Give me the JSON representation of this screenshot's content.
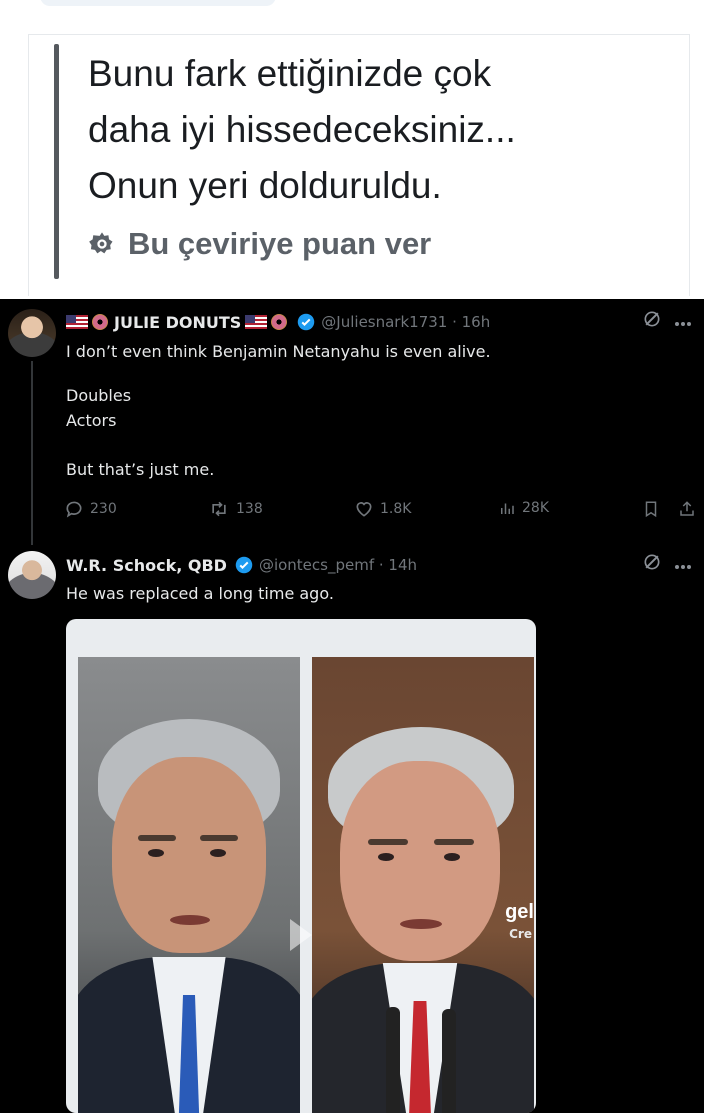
{
  "translation": {
    "lines": [
      "Bunu fark ettiğinizde çok",
      "daha iyi hissedeceksiniz...",
      "Onun yeri dolduruldu."
    ],
    "rate_label": "Bu çeviriye puan ver",
    "rate_icon": "gear-icon"
  },
  "embedded": {
    "post1": {
      "display_name": "JULIE DONUTS",
      "handle": "@Juliesnark1731 · 16h",
      "text_line1": "I don’t even think Benjamin Netanyahu is even alive.",
      "text_lines2": [
        "Doubles",
        "Actors"
      ],
      "text_line3": "But that’s just me.",
      "stats": {
        "replies": "230",
        "reposts": "138",
        "likes": "1.8K",
        "views": "28K"
      }
    },
    "post2": {
      "display_name": "W.R. Schock, QBD",
      "handle": "@iontecs_pemf · 14h",
      "text": "He was replaced a long time ago.",
      "image_overlay_text": "gel",
      "image_overlay_sub": "Cre"
    },
    "colors": {
      "background": "#000000",
      "text": "#e7e9ea",
      "muted": "#71767b",
      "verified": "#1d9bf0"
    }
  }
}
